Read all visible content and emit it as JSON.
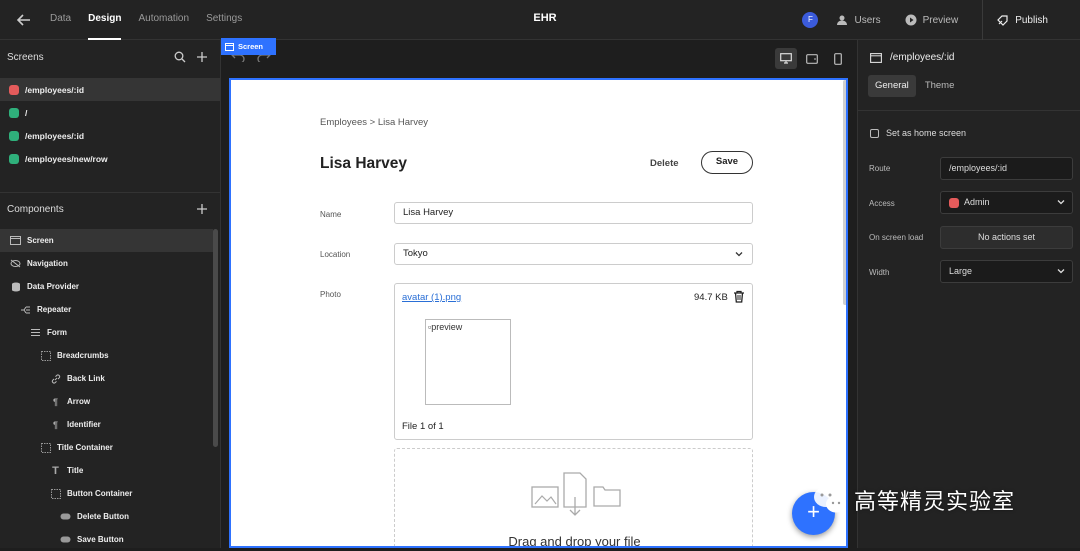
{
  "topbar": {
    "tabs": [
      "Data",
      "Design",
      "Automation",
      "Settings"
    ],
    "active_tab": "Design",
    "app_title": "EHR",
    "user_initial": "F",
    "users_label": "Users",
    "preview_label": "Preview",
    "publish_label": "Publish"
  },
  "left": {
    "screens_title": "Screens",
    "screens": [
      {
        "route": "/employees/:id",
        "color": "#e45b5b",
        "active": true
      },
      {
        "route": "/",
        "color": "#2fb07b",
        "active": false
      },
      {
        "route": "/employees/:id",
        "color": "#2fb07b",
        "active": false
      },
      {
        "route": "/employees/new/row",
        "color": "#2fb07b",
        "active": false
      }
    ],
    "components_title": "Components",
    "components": [
      {
        "label": "Screen",
        "icon": "screen-icon",
        "indent": 0
      },
      {
        "label": "Navigation",
        "icon": "eye-off-icon",
        "indent": 0
      },
      {
        "label": "Data Provider",
        "icon": "database-icon",
        "indent": 0
      },
      {
        "label": "Repeater",
        "icon": "repeater-icon",
        "indent": 1
      },
      {
        "label": "Form",
        "icon": "form-icon",
        "indent": 2
      },
      {
        "label": "Breadcrumbs",
        "icon": "box-icon",
        "indent": 3
      },
      {
        "label": "Back Link",
        "icon": "link-icon",
        "indent": 4
      },
      {
        "label": "Arrow",
        "icon": "paragraph-icon",
        "indent": 4
      },
      {
        "label": "Identifier",
        "icon": "paragraph-icon",
        "indent": 4
      },
      {
        "label": "Title Container",
        "icon": "box-icon",
        "indent": 3
      },
      {
        "label": "Title",
        "icon": "heading-icon",
        "indent": 4
      },
      {
        "label": "Button Container",
        "icon": "box-icon",
        "indent": 4
      },
      {
        "label": "Delete Button",
        "icon": "button-icon",
        "indent": 5
      },
      {
        "label": "Save Button",
        "icon": "button-icon",
        "indent": 5
      }
    ]
  },
  "canvas": {
    "screen_tag": "Screen",
    "breadcrumb": "Employees > Lisa Harvey",
    "title": "Lisa Harvey",
    "delete_label": "Delete",
    "save_label": "Save",
    "name_label": "Name",
    "name_value": "Lisa Harvey",
    "location_label": "Location",
    "location_value": "Tokyo",
    "photo_label": "Photo",
    "file_name": "avatar (1).png",
    "file_size": "94.7 KB",
    "preview_alt": "preview",
    "file_count": "File 1 of 1",
    "drop_text": "Drag and drop your file"
  },
  "right": {
    "route_title": "/employees/:id",
    "tabs": [
      "General",
      "Theme"
    ],
    "active_tab": "General",
    "home_screen_label": "Set as home screen",
    "route_label": "Route",
    "route_value": "/employees/:id",
    "access_label": "Access",
    "access_value": "Admin",
    "access_color": "#e45b5b",
    "onload_label": "On screen load",
    "onload_value": "No actions set",
    "width_label": "Width",
    "width_value": "Large"
  },
  "watermark": {
    "text": "高等精灵实验室"
  }
}
